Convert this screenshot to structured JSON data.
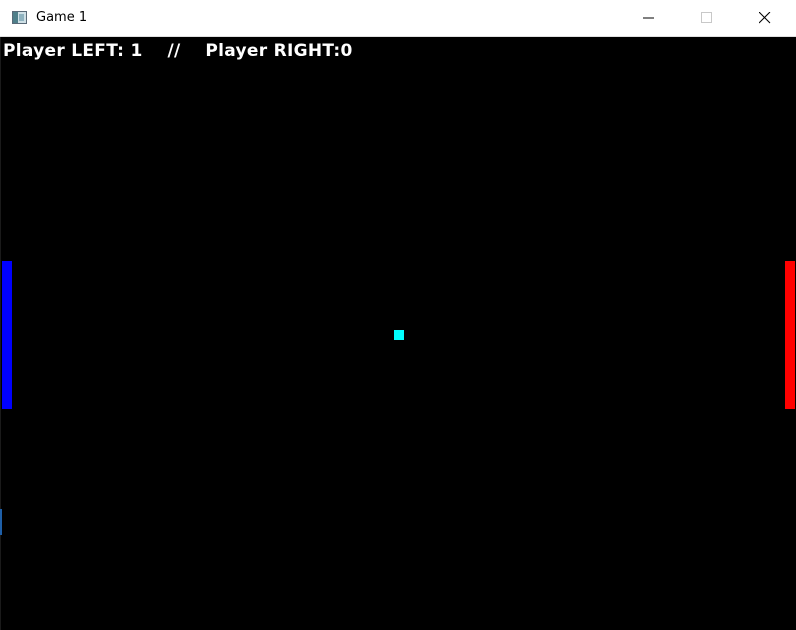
{
  "window": {
    "title": "Game 1",
    "icon": "app-window-icon",
    "controls": {
      "minimize_icon": "minimize-icon",
      "maximize_icon": "maximize-icon",
      "close_icon": "close-icon"
    }
  },
  "game": {
    "score_text": "Player LEFT: 1    //    Player RIGHT:0",
    "score_left": 1,
    "score_right": 0,
    "colors": {
      "background": "#000000",
      "left_paddle": "#0000ff",
      "right_paddle": "#ff0000",
      "ball": "#00ffff",
      "score_text": "#ffffff"
    }
  }
}
